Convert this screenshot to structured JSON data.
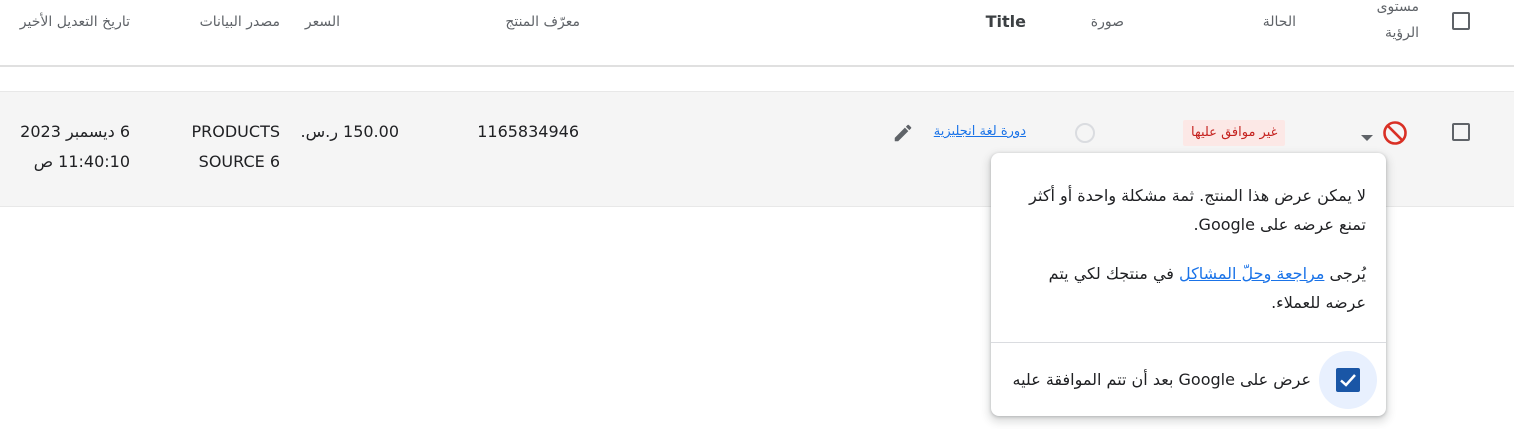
{
  "header": {
    "visibility_line1": "مستوى",
    "visibility_line2": "الرؤية",
    "status": "الحالة",
    "image": "صورة",
    "title": "Title",
    "product_id": "معرّف المنتج",
    "price": "السعر",
    "data_source": "مصدر البيانات",
    "last_modified": "تاريخ التعديل الأخير"
  },
  "row": {
    "status": "غير موافق عليها",
    "title": "دورة لغة انجليزية",
    "product_id": "1165834946",
    "price": "150.00 ر.س.",
    "data_source_line1": "PRODUCTS",
    "data_source_line2": "SOURCE 6",
    "modified_line1": "6 ديسمبر 2023",
    "modified_line2": "11:40:10 ص"
  },
  "popover": {
    "message": "لا يمكن عرض هذا المنتج. ثمة مشكلة واحدة أو أكثر تمنع عرضه على Google.",
    "prompt_before": "يُرجى ",
    "prompt_link": "مراجعة وحلّ المشاكل",
    "prompt_after": " في منتجك لكي يتم عرضه للعملاء.",
    "checkbox_label": "عرض على Google بعد أن تتم الموافقة عليه"
  },
  "colors": {
    "status_text": "#c5221f",
    "status_bg": "#fce8e6",
    "link": "#1a73e8",
    "checkbox_checked": "#1a56a6"
  },
  "icons": {
    "visibility": "block-icon",
    "dropdown": "arrow-drop-down-icon",
    "edit": "pencil-icon",
    "image": "loading-spinner-icon",
    "checked": "check-icon"
  }
}
